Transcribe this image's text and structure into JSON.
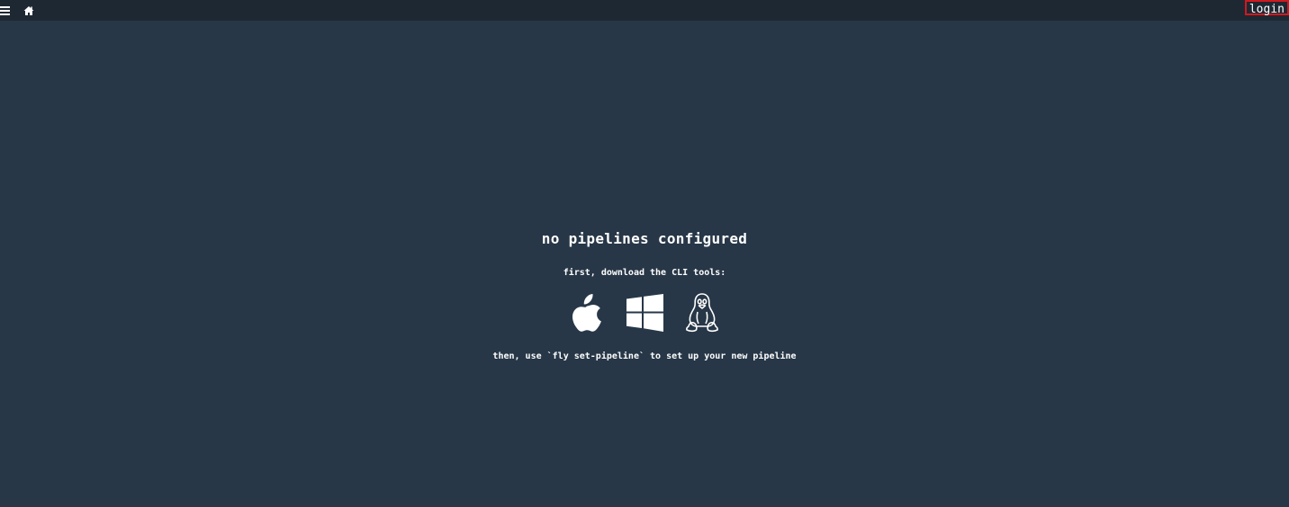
{
  "topbar": {
    "menu_icon": "hamburger-menu-icon",
    "home_icon": "home-icon",
    "login_label": "login",
    "colors": {
      "background": "#1e2833",
      "login_border": "#d0191f"
    }
  },
  "main": {
    "title": "no pipelines configured",
    "subtitle": "first, download the CLI tools:",
    "downloads": [
      {
        "icon": "apple-icon"
      },
      {
        "icon": "windows-icon"
      },
      {
        "icon": "linux-tux-icon"
      }
    ],
    "instruction": "then, use `fly set-pipeline` to set up your new pipeline",
    "colors": {
      "background": "#273747",
      "text": "#ffffff"
    }
  }
}
